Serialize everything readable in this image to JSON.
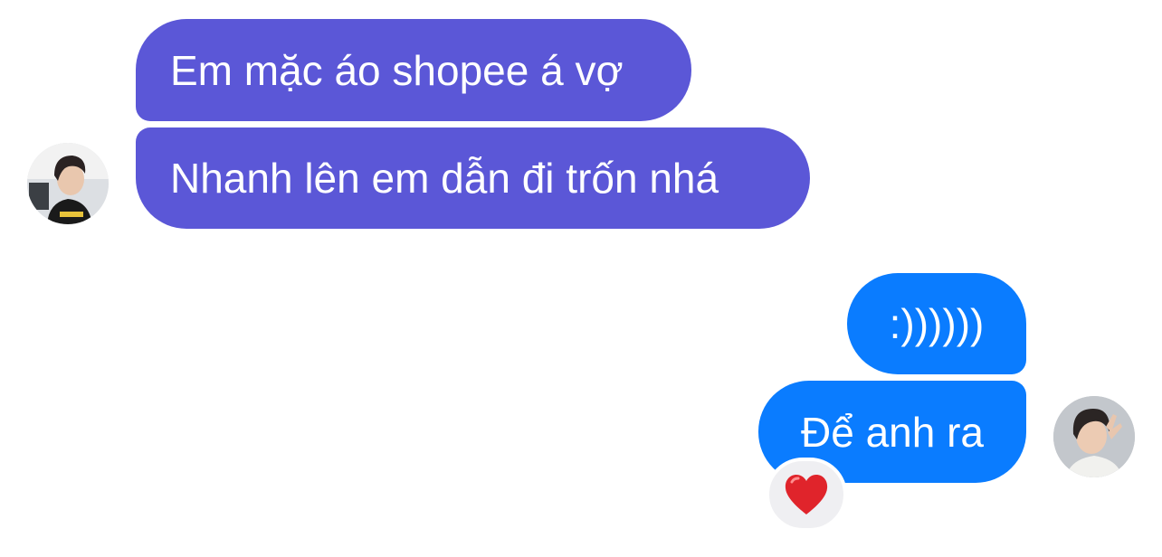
{
  "conversation": {
    "incoming": [
      {
        "text": "Em mặc áo shopee á vợ"
      },
      {
        "text": "Nhanh lên em dẫn đi trốn nhá"
      }
    ],
    "outgoing": [
      {
        "text": ":))))))"
      },
      {
        "text": "Để anh ra"
      }
    ],
    "reaction": {
      "icon": "heart-icon",
      "color": "#e0242b"
    }
  },
  "colors": {
    "incoming_bubble": "#5b57d7",
    "outgoing_bubble": "#0a7cff",
    "bubble_text": "#ffffff",
    "background": "#ffffff"
  }
}
